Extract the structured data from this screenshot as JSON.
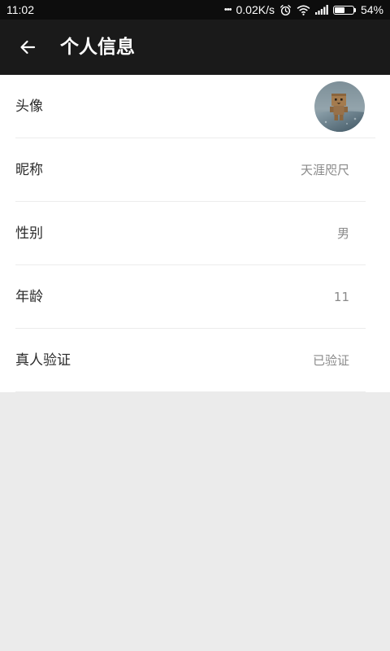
{
  "status_bar": {
    "time": "11:02",
    "dots": "•••",
    "network_speed": "0.02K/s",
    "battery_percent": "54%",
    "battery_level": 0.54,
    "icons": [
      "alarm-icon",
      "wifi-icon",
      "signal-icon",
      "battery-icon"
    ]
  },
  "app_bar": {
    "back_icon": "back-arrow-icon",
    "title": "个人信息"
  },
  "profile": {
    "rows": [
      {
        "label": "头像",
        "type": "avatar"
      },
      {
        "label": "昵称",
        "value": "天涯咫尺"
      },
      {
        "label": "性别",
        "value": "男"
      },
      {
        "label": "年龄",
        "value": "11"
      },
      {
        "label": "真人验证",
        "value": "已验证"
      }
    ]
  },
  "colors": {
    "status_bar_bg": "#0d0d0d",
    "app_bar_bg": "#1a1a1a",
    "page_bg": "#ebebeb",
    "row_bg": "#ffffff",
    "label_text": "#2b2b2b",
    "value_text": "#8a8a8a",
    "divider": "#ececec"
  }
}
